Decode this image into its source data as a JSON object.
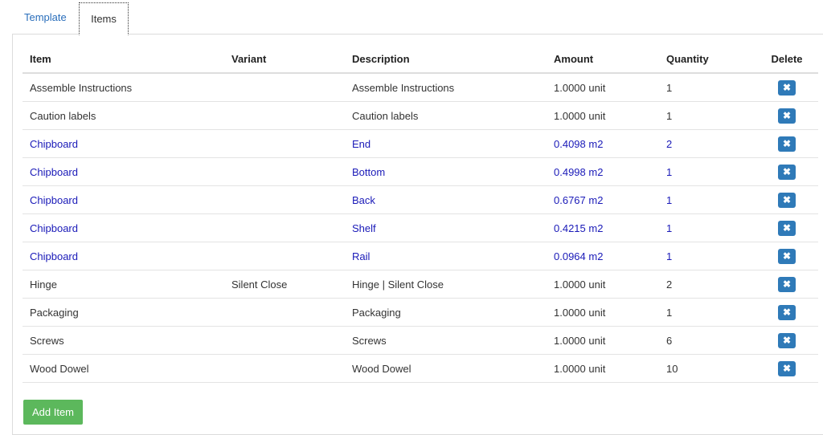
{
  "tabs": [
    {
      "label": "Template"
    },
    {
      "label": "Items"
    }
  ],
  "table": {
    "headers": {
      "item": "Item",
      "variant": "Variant",
      "description": "Description",
      "amount": "Amount",
      "quantity": "Quantity",
      "delete": "Delete"
    },
    "rows": [
      {
        "item": "Assemble Instructions",
        "variant": "",
        "description": "Assemble Instructions",
        "amount": "1.0000 unit",
        "quantity": "1"
      },
      {
        "item": "Caution labels",
        "variant": "",
        "description": "Caution labels",
        "amount": "1.0000 unit",
        "quantity": "1"
      },
      {
        "item": "Chipboard",
        "variant": "",
        "description": "End",
        "amount": "0.4098 m2",
        "quantity": "2"
      },
      {
        "item": "Chipboard",
        "variant": "",
        "description": "Bottom",
        "amount": "0.4998 m2",
        "quantity": "1"
      },
      {
        "item": "Chipboard",
        "variant": "",
        "description": "Back",
        "amount": "0.6767 m2",
        "quantity": "1"
      },
      {
        "item": "Chipboard",
        "variant": "",
        "description": "Shelf",
        "amount": "0.4215 m2",
        "quantity": "1"
      },
      {
        "item": "Chipboard",
        "variant": "",
        "description": "Rail",
        "amount": "0.0964 m2",
        "quantity": "1"
      },
      {
        "item": "Hinge",
        "variant": "Silent Close",
        "description": "Hinge | Silent Close",
        "amount": "1.0000 unit",
        "quantity": "2"
      },
      {
        "item": "Packaging",
        "variant": "",
        "description": "Packaging",
        "amount": "1.0000 unit",
        "quantity": "1"
      },
      {
        "item": "Screws",
        "variant": "",
        "description": "Screws",
        "amount": "1.0000 unit",
        "quantity": "6"
      },
      {
        "item": "Wood Dowel",
        "variant": "",
        "description": "Wood Dowel",
        "amount": "1.0000 unit",
        "quantity": "10"
      }
    ],
    "delete_icon": "close-icon",
    "delete_glyph": "✖"
  },
  "add_item_label": "Add Item",
  "colors": {
    "link": "#2a6ebb",
    "highlight_row_text": "#1a1ab8",
    "delete_button": "#2f7ab8",
    "add_button": "#5cb85c"
  }
}
